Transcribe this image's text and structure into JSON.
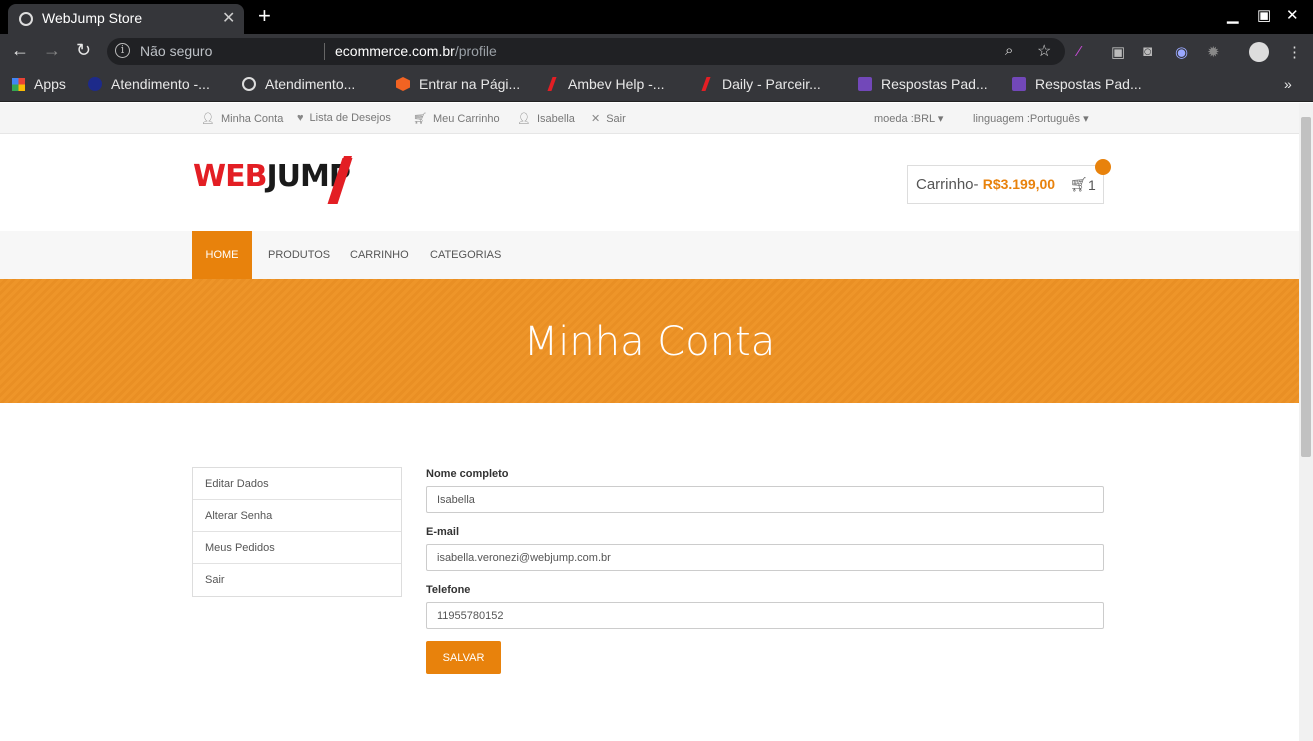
{
  "browser": {
    "tab_title": "WebJump Store",
    "address_insecure": "Não seguro",
    "url_domain": "ecommerce.com.br",
    "url_path": "/profile",
    "bookmarks": [
      {
        "label": "Apps",
        "icon": "apps-grid-icon"
      },
      {
        "label": "Atendimento -...",
        "icon": "site-icon"
      },
      {
        "label": "Atendimento...",
        "icon": "globe-icon"
      },
      {
        "label": "Entrar na Pági...",
        "icon": "magento-icon"
      },
      {
        "label": "Ambev Help -...",
        "icon": "webjump-icon"
      },
      {
        "label": "Daily - Parceir...",
        "icon": "webjump-icon"
      },
      {
        "label": "Respostas Pad...",
        "icon": "docs-icon"
      },
      {
        "label": "Respostas Pad...",
        "icon": "docs-icon"
      }
    ]
  },
  "topbar": {
    "minha_conta": "Minha Conta",
    "lista_desejos": "Lista de Desejos",
    "meu_carrinho": "Meu Carrinho",
    "user": "Isabella",
    "sair": "Sair",
    "moeda": "moeda :BRL",
    "linguagem": "linguagem :Português"
  },
  "header": {
    "logo_web": "WEB",
    "logo_jump": "JUMP",
    "cart_label": "Carrinho-",
    "cart_price": "R$3.199,00",
    "cart_count": "1"
  },
  "menu": [
    "Home",
    "Produtos",
    "Carrinho",
    "Categorias"
  ],
  "banner_title": "Minha Conta",
  "sidebar": [
    "Editar Dados",
    "Alterar Senha",
    "Meus Pedidos",
    "Sair"
  ],
  "form": {
    "name_label": "Nome completo",
    "name_value": "Isabella",
    "email_label": "E-mail",
    "email_value": "isabella.veronezi@webjump.com.br",
    "phone_label": "Telefone",
    "phone_value": "11955780152",
    "save_label": "Salvar"
  },
  "colors": {
    "accent": "#e8820c",
    "logo_red": "#e31e24"
  }
}
